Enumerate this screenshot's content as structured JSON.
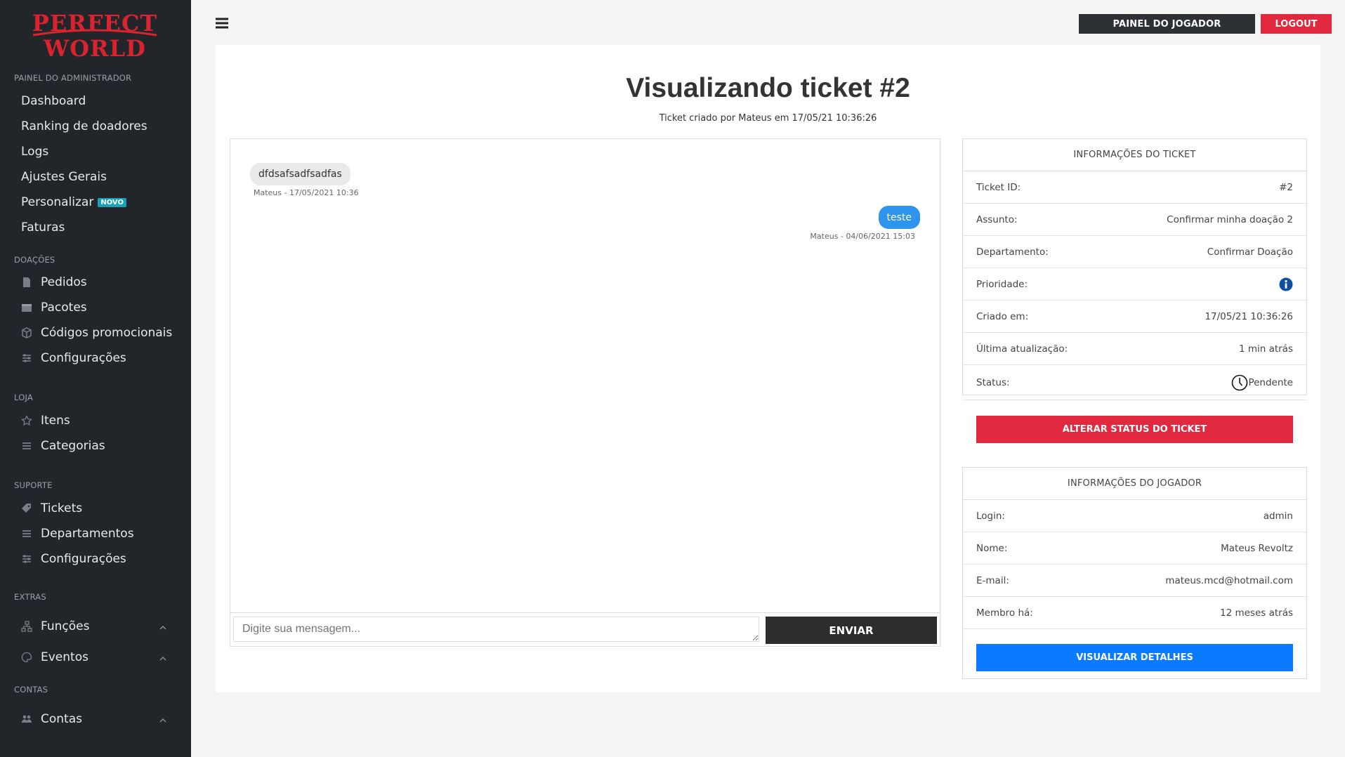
{
  "brand": {
    "line1": "PERFECT",
    "line2": "WORLD",
    "color": "#d9232e"
  },
  "sidebar": {
    "section_admin": "PAINEL DO ADMINISTRADOR",
    "admin_items": [
      "Dashboard",
      "Ranking de doadores",
      "Logs",
      "Ajustes Gerais",
      "Personalizar",
      "Faturas"
    ],
    "badge_novo": "NOVO",
    "section_doacoes": "DOAÇÕES",
    "doacoes_items": [
      "Pedidos",
      "Pacotes",
      "Códigos promocionais",
      "Configurações"
    ],
    "section_loja": "LOJA",
    "loja_items": [
      "Itens",
      "Categorias"
    ],
    "section_suporte": "SUPORTE",
    "suporte_items": [
      "Tickets",
      "Departamentos",
      "Configurações"
    ],
    "section_extras": "EXTRAS",
    "extras_items": [
      "Funções",
      "Eventos"
    ],
    "section_contas": "CONTAS",
    "contas_items": [
      "Contas"
    ]
  },
  "header": {
    "painel_btn": "PAINEL DO JOGADOR",
    "logout_btn": "LOGOUT"
  },
  "page": {
    "title": "Visualizando ticket #2",
    "subtitle": "Ticket criado por Mateus em 17/05/21 10:36:26"
  },
  "chat": {
    "messages": [
      {
        "text": "dfdsafsadfsadfas",
        "meta": "Mateus - 17/05/2021 10:36",
        "side": "left"
      },
      {
        "text": "teste",
        "meta": "Mateus - 04/06/2021 15:03",
        "side": "right"
      }
    ],
    "input_placeholder": "Digite sua mensagem...",
    "send_label": "ENVIAR"
  },
  "ticket_info": {
    "heading": "INFORMAÇÕES DO TICKET",
    "rows": [
      {
        "label": "Ticket ID:",
        "value": "#2"
      },
      {
        "label": "Assunto:",
        "value": "Confirmar minha doação 2"
      },
      {
        "label": "Departamento:",
        "value": "Confirmar Doação"
      },
      {
        "label": "Prioridade:",
        "value": ""
      },
      {
        "label": "Criado em:",
        "value": "17/05/21 10:36:26"
      },
      {
        "label": "Última atualização:",
        "value": "1 min atrás"
      },
      {
        "label": "Status:",
        "value": "Pendente"
      }
    ],
    "action_label": "ALTERAR STATUS DO TICKET"
  },
  "player_info": {
    "heading": "INFORMAÇÕES DO JOGADOR",
    "rows": [
      {
        "label": "Login:",
        "value": "admin"
      },
      {
        "label": "Nome:",
        "value": "Mateus Revoltz"
      },
      {
        "label": "E-mail:",
        "value": "mateus.mcd@hotmail.com"
      },
      {
        "label": "Membro há:",
        "value": "12 meses atrás"
      }
    ],
    "action_label": "VISUALIZAR DETALHES"
  },
  "colors": {
    "sidebar_bg": "#222529",
    "danger": "#e0283e",
    "primary": "#0a7bff",
    "chat_bubble": "#2f95ec",
    "info_icon": "#0d4fa3"
  }
}
